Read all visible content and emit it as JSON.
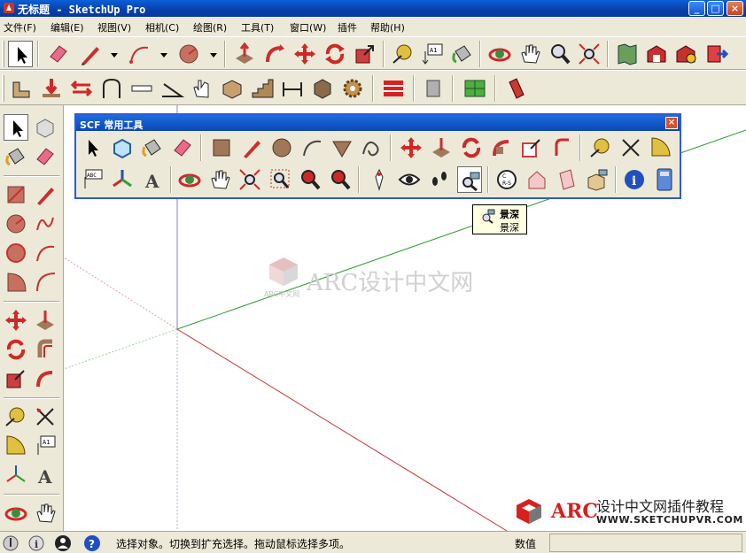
{
  "window": {
    "title": "无标题 - SketchUp Pro",
    "minimize": "_",
    "maximize": "□",
    "close": "×",
    "app_icon": "sketchup-icon"
  },
  "menubar": {
    "items": [
      "文件(F)",
      "编辑(E)",
      "视图(V)",
      "相机(C)",
      "绘图(R)",
      "工具(T)",
      "窗口(W)",
      "插件",
      "帮助(H)"
    ]
  },
  "scf_panel": {
    "title": "SCF 常用工具",
    "close": "×"
  },
  "tooltip": {
    "title": "景深",
    "text": "景深",
    "icon": "camera-lens-icon"
  },
  "watermark": {
    "center_text": "ARC设计中文网",
    "center_small": "ARC中文网",
    "brand": "ARC",
    "brand_line1": "设计中文网插件教程",
    "brand_line2": "WWW.SKETCHUPVR.COM"
  },
  "statusbar": {
    "text": "选择对象。切换到扩充选择。拖动鼠标选择多项。",
    "measure_label": "数值",
    "measure_value": ""
  },
  "colors": {
    "axis_green": "#2ea02e",
    "axis_red": "#c83232",
    "axis_blue": "#4848c8",
    "titlebar": "#0a5fd8",
    "tooltip_bg": "#ffffe1"
  }
}
